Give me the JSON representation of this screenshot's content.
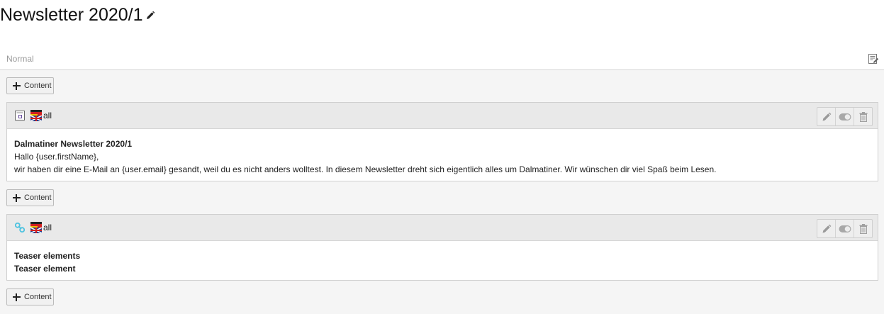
{
  "page": {
    "title": "Newsletter 2020/1",
    "edit_title_icon": "pencil-icon"
  },
  "column": {
    "name": "Normal",
    "edit_icon": "edit-column-icon"
  },
  "add_content": {
    "label": "Content",
    "icon": "plus-icon"
  },
  "elements": [
    {
      "type_icon": "text-element-icon",
      "flag_icon": "multilanguage-flag-icon",
      "language": "all",
      "headline": "Dalmatiner Newsletter 2020/1",
      "lines": [
        "Hallo {user.firstName},",
        "wir haben dir eine E-Mail an {user.email} gesandt, weil du es nicht anders wolltest. In diesem Newsletter dreht sich eigentlich alles um Dalmatiner. Wir wünschen dir viel Spaß beim Lesen."
      ],
      "actions": [
        "edit-icon",
        "toggle-icon",
        "delete-icon"
      ]
    },
    {
      "type_icon": "link-element-icon",
      "flag_icon": "multilanguage-flag-icon",
      "language": "all",
      "headline": "Teaser elements",
      "lines_bold": [
        "Teaser element"
      ],
      "actions": [
        "edit-icon",
        "toggle-icon",
        "delete-icon"
      ]
    }
  ],
  "colors": {
    "column_bg": "#f5f5f5",
    "element_header_bg": "#e9e9e9",
    "link_icon": "#4fc3e0",
    "flag_red": "#d22020",
    "flag_gold": "#f2c200",
    "flag_blue": "#1e3a8a"
  }
}
